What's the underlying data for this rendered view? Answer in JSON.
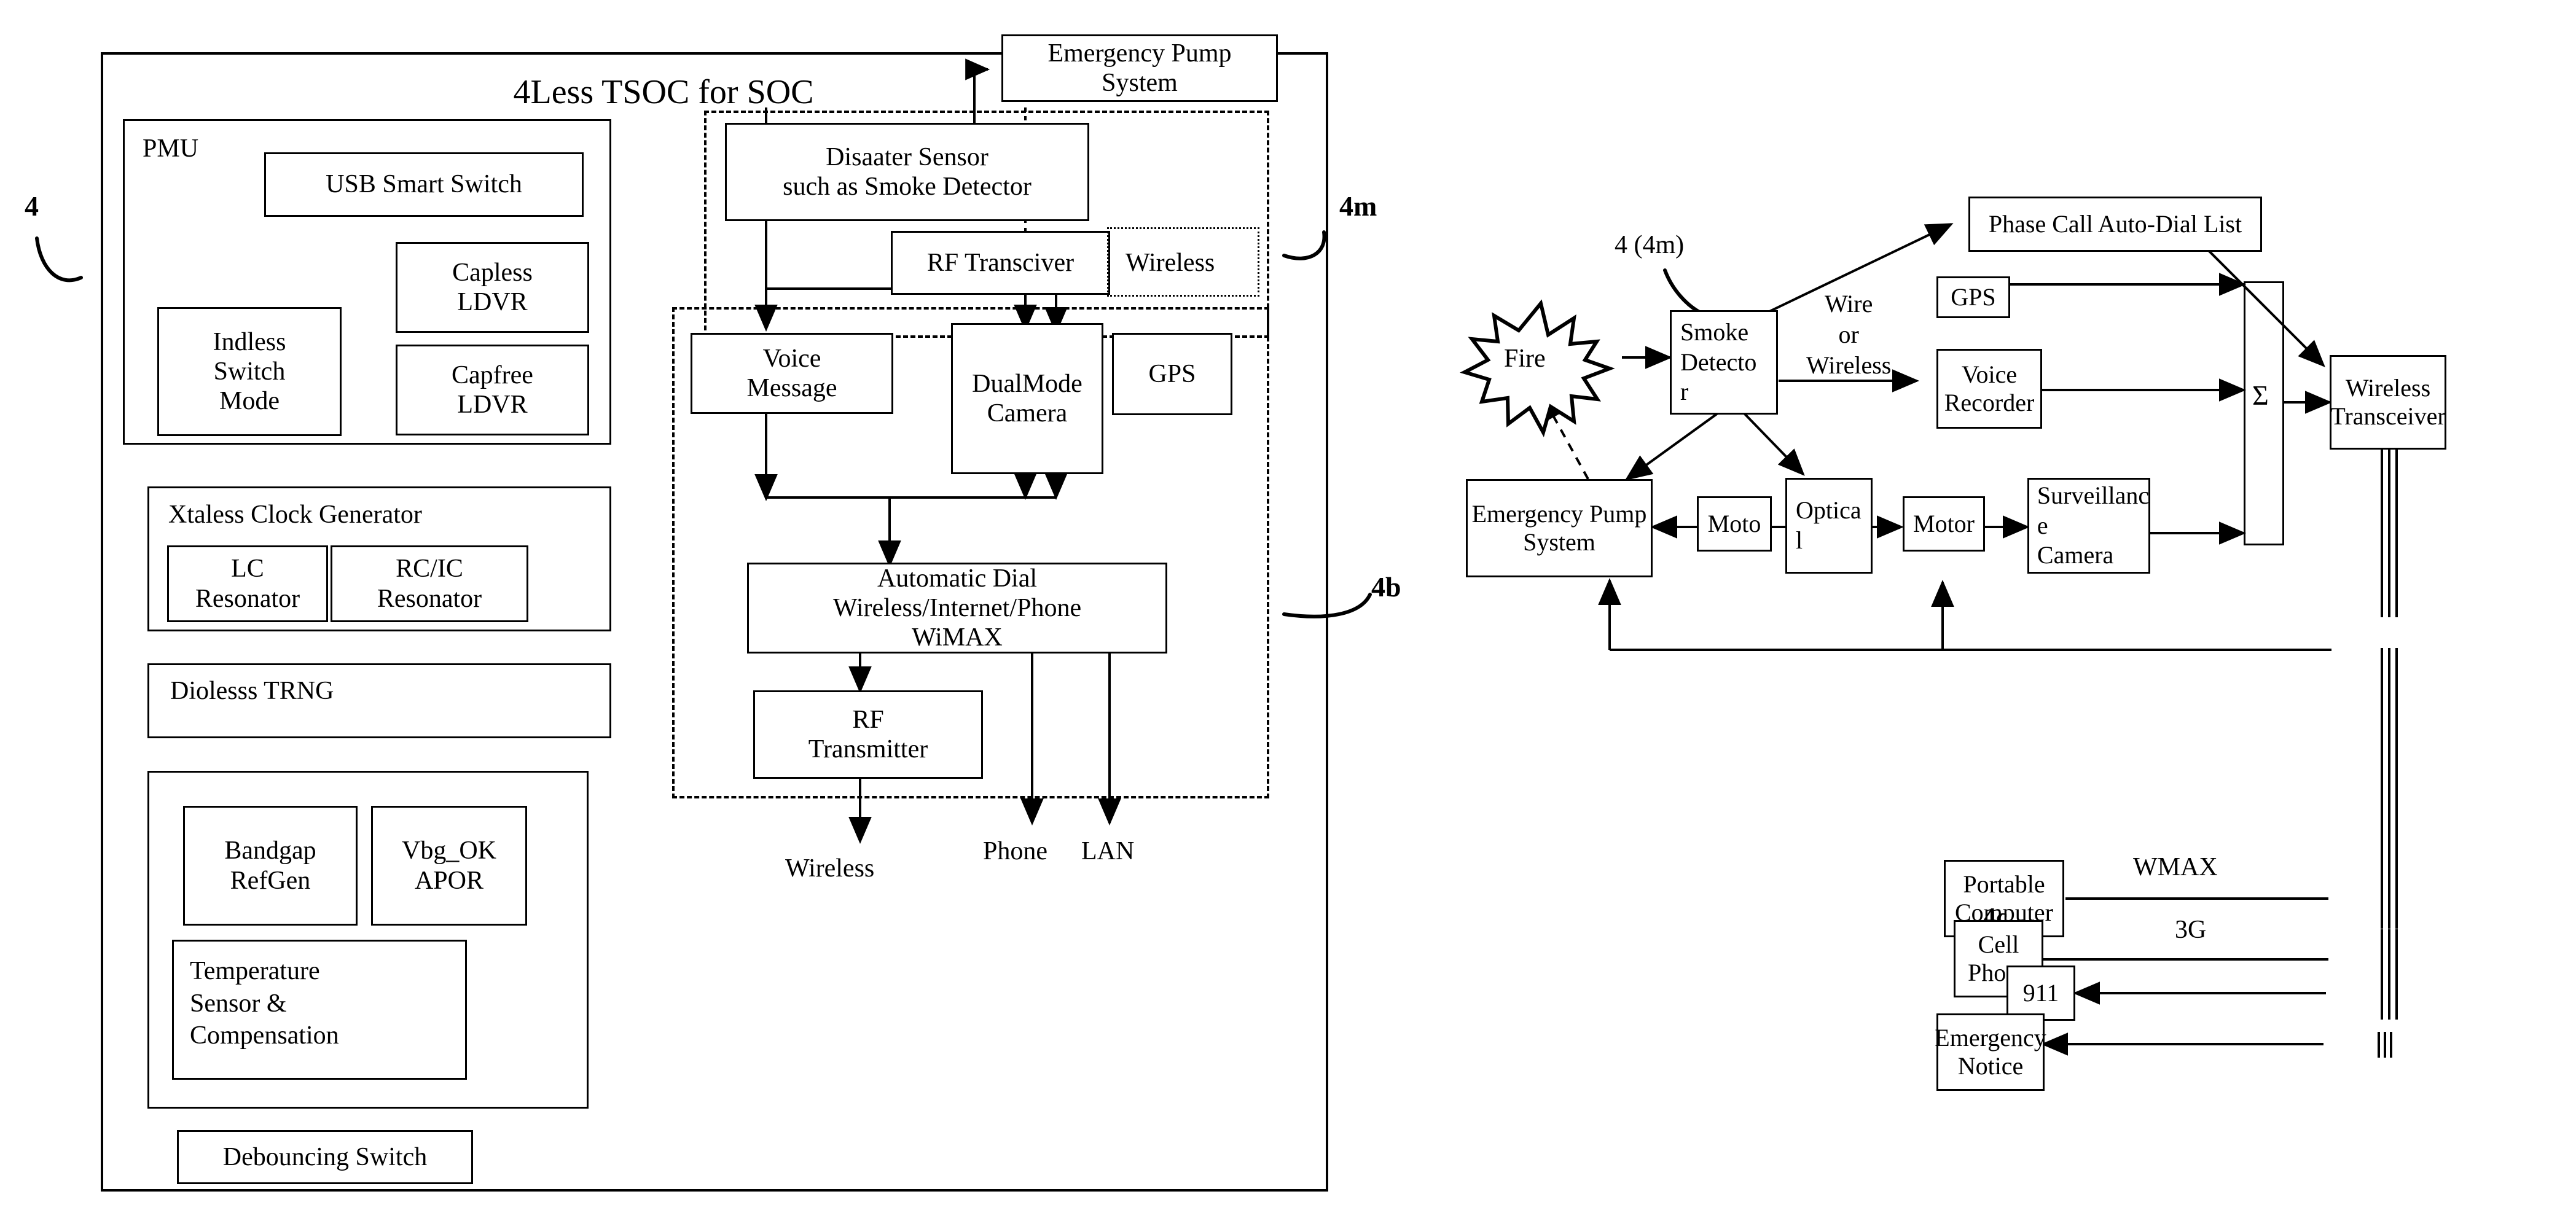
{
  "figure": {
    "left_diagram": {
      "title": "4Less  TSOC for SOC",
      "ref_label_outer": "4",
      "ref_label_sensor_block": "4m",
      "ref_label_comm_block": "4b",
      "pmu": {
        "group_label": "PMU",
        "blocks": [
          {
            "label": "USB Smart Switch"
          },
          {
            "label": "Capless\nLDVR"
          },
          {
            "label": "Capfree\nLDVR"
          },
          {
            "label": "Indless\nSwitch\nMode"
          }
        ]
      },
      "clock": {
        "group_label": "Xtaless Clock Generator",
        "blocks": [
          {
            "label": "LC\nResonator"
          },
          {
            "label": "RC/IC\nResonator"
          }
        ]
      },
      "trng": {
        "label": "Diolesss TRNG"
      },
      "analog": {
        "blocks": [
          {
            "label": "Bandgap\nRefGen"
          },
          {
            "label": "Vbg_OK\nAPOR"
          },
          {
            "label": "Temperature\nSensor &\nCompensation"
          }
        ]
      },
      "debounce": {
        "label": "Debouncing Switch"
      },
      "right_column": {
        "emergency_pump": "Emergency Pump\nSystem",
        "disaster_sensor": "Disaater Sensor\nsuch as Smoke Detector",
        "rf_transceiver": "RF Transciver",
        "wireless_tag": "Wireless",
        "voice_message": "Voice\nMessage",
        "dualmode_camera": "DualMode\nCamera",
        "gps": "GPS",
        "automatic_dial": "Automatic Dial\nWireless/Internet/Phone\nWiMAX",
        "rf_transmitter": "RF\nTransmitter",
        "out_wireless": "Wireless",
        "out_phone": "Phone",
        "out_lan": "LAN"
      }
    },
    "right_diagram": {
      "ref_label_detector": "4 (4m)",
      "ref_label_cell": "4c",
      "fire": "Fire",
      "smoke_detector": "Smoke\nDetecto\nr",
      "wire_or_wireless": "Wire\nor\nWireless",
      "phase_call_list": "Phase Call Auto-Dial List",
      "gps": "GPS",
      "voice_recorder": "Voice\nRecorder",
      "summation_symbol": "Σ",
      "wireless_transceiver": "Wireless\nTransceiver",
      "emergency_pump": "Emergency Pump\nSystem",
      "moto": "Moto",
      "optical": "Optica\nl",
      "motor": "Motor",
      "surveillance_camera": "Surveillanc\ne\nCamera",
      "portable_computer": "Portable\nComputer",
      "wmax": "WMAX",
      "cell_phone": "Cell\nPhone",
      "three_g": "3G",
      "nine_one_one": "911",
      "emergency_notice": "Emergency\nNotice"
    }
  },
  "style": {
    "ink": "#000000",
    "paper": "#ffffff"
  }
}
